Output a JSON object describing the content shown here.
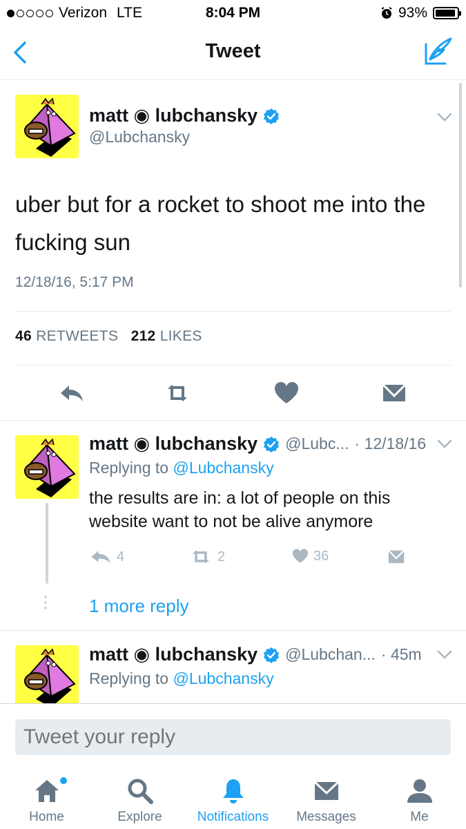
{
  "status_bar": {
    "carrier": "Verizon",
    "network": "LTE",
    "time": "8:04 PM",
    "battery": "93%",
    "battery_level": 0.93,
    "signal_bars": 1
  },
  "nav": {
    "title": "Tweet"
  },
  "main_tweet": {
    "name": "matt ◉ lubchansky",
    "handle": "@Lubchansky",
    "text": "uber but for a rocket to shoot me into the fucking sun",
    "timestamp": "12/18/16, 5:17 PM",
    "retweets_count": "46",
    "retweets_label": "RETWEETS",
    "likes_count": "212",
    "likes_label": "LIKES"
  },
  "replies": [
    {
      "name": "matt ◉ lubchansky",
      "handle": "@Lubc...",
      "time": "· 12/18/16",
      "replying_prefix": "Replying to",
      "replying_handle": "@Lubchansky",
      "text": "the results are in: a lot of people on this website want to not be alive anymore",
      "reply_count": "4",
      "retweet_count": "2",
      "like_count": "36",
      "more_replies": "1 more reply"
    },
    {
      "name": "matt ◉ lubchansky",
      "handle": "@Lubchan...",
      "time": "· 45m",
      "replying_prefix": "Replying to",
      "replying_handle": "@Lubchansky"
    }
  ],
  "composer": {
    "placeholder": "Tweet your reply"
  },
  "tabs": [
    {
      "label": "Home",
      "icon": "home-icon"
    },
    {
      "label": "Explore",
      "icon": "search-icon"
    },
    {
      "label": "Notifications",
      "icon": "bell-icon"
    },
    {
      "label": "Messages",
      "icon": "envelope-icon"
    },
    {
      "label": "Me",
      "icon": "person-icon"
    }
  ],
  "colors": {
    "accent": "#1da1f2",
    "secondary_text": "#657786",
    "avatar_bg": "#ffff44"
  }
}
